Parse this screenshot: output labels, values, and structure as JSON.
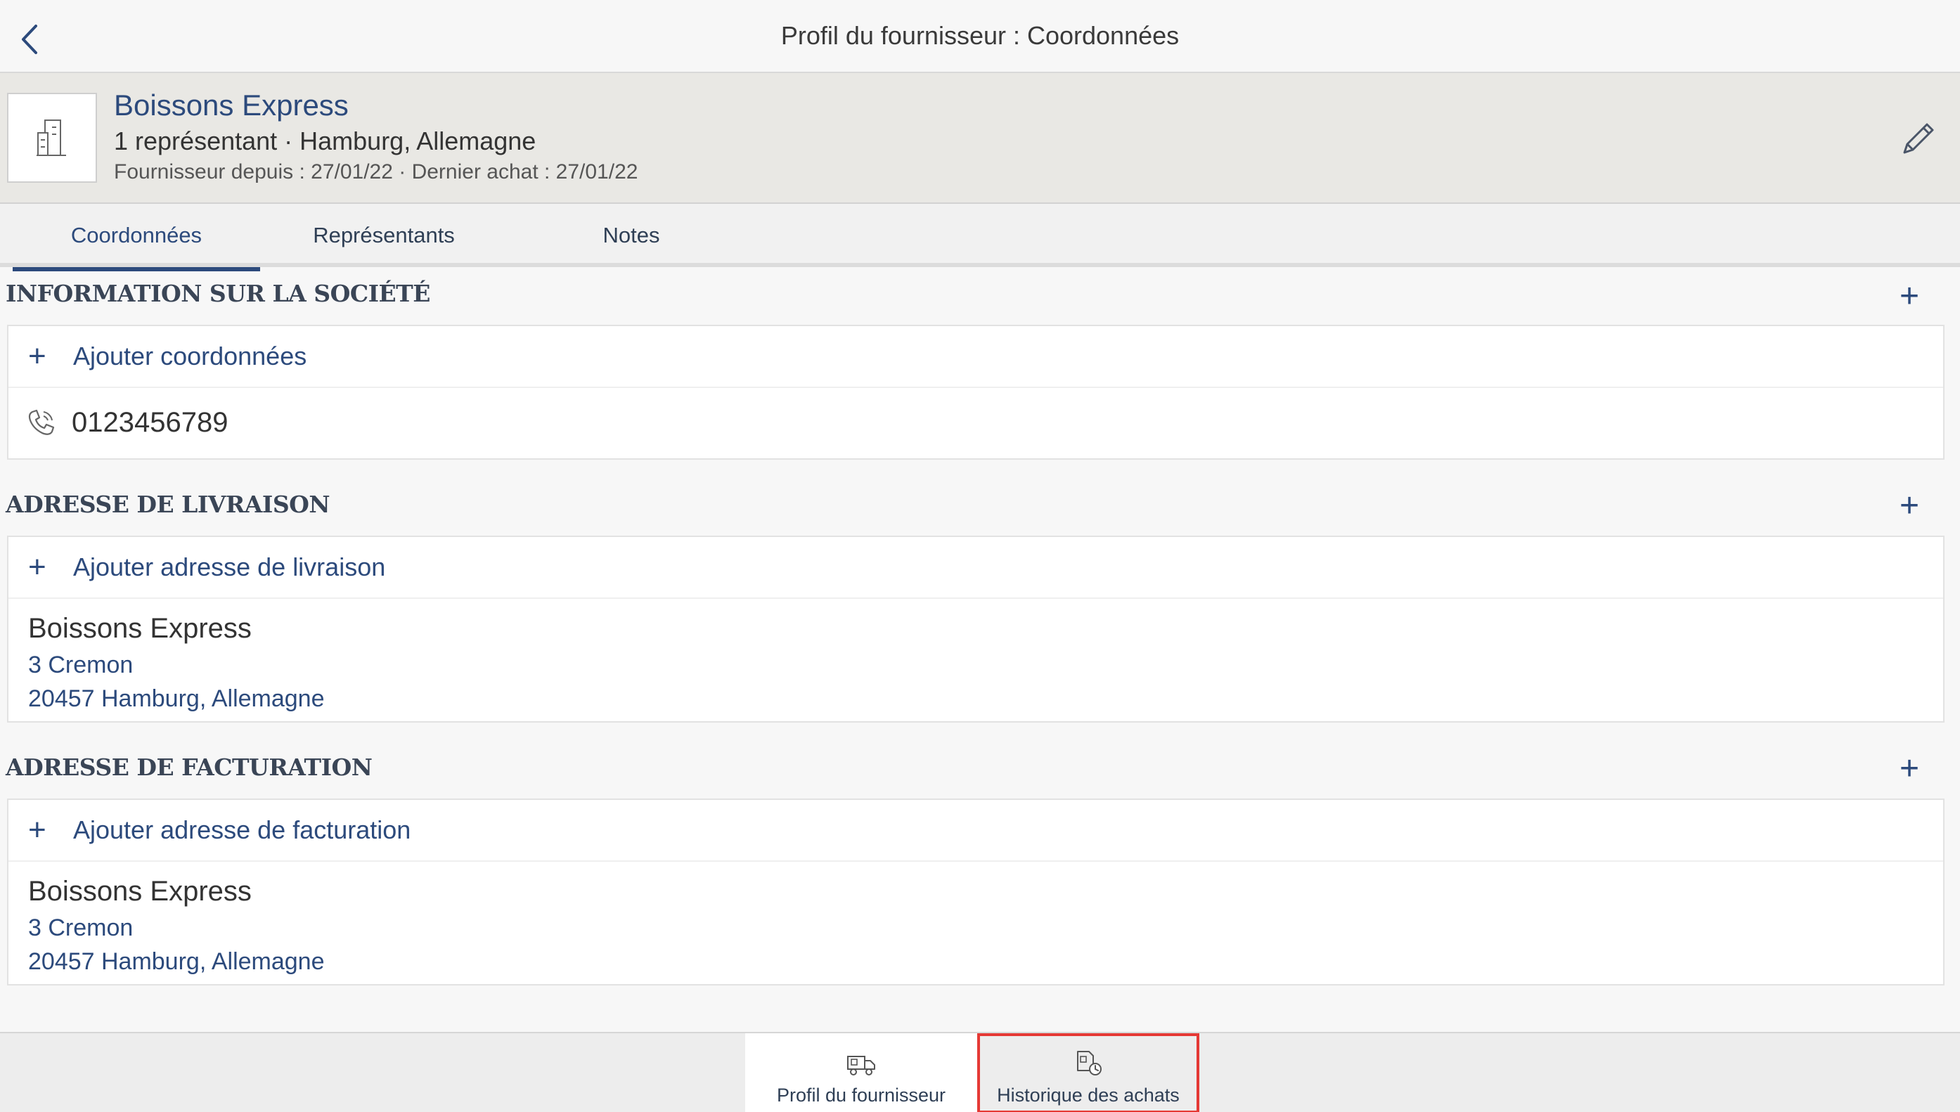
{
  "topbar": {
    "title": "Profil du fournisseur : Coordonnées"
  },
  "supplier": {
    "name": "Boissons Express",
    "subtitle": "1 représentant · Hamburg, Allemagne",
    "meta": "Fournisseur depuis : 27/01/22 · Dernier achat : 27/01/22"
  },
  "tabs": [
    {
      "label": "Coordonnées",
      "active": true
    },
    {
      "label": "Représentants",
      "active": false
    },
    {
      "label": "Notes",
      "active": false
    }
  ],
  "company_info": {
    "title": "INFORMATION SUR LA SOCIÉTÉ",
    "add_label": "Ajouter coordonnées",
    "phone": "0123456789"
  },
  "delivery": {
    "title": "ADRESSE DE LIVRAISON",
    "add_label": "Ajouter adresse de livraison",
    "name": "Boissons Express",
    "street": "3 Cremon",
    "city": "20457 Hamburg, Allemagne"
  },
  "billing": {
    "title": "ADRESSE DE FACTURATION",
    "add_label": "Ajouter adresse de facturation",
    "name": "Boissons Express",
    "street": "3 Cremon",
    "city": "20457 Hamburg, Allemagne"
  },
  "plus_glyph": "+",
  "bottom_nav": [
    {
      "label": "Profil du fournisseur",
      "icon": "truck-icon",
      "active": true
    },
    {
      "label": "Historique des achats",
      "icon": "purchase-history-icon",
      "active": false,
      "highlighted": true
    }
  ],
  "colors": {
    "accent": "#2c4a7c",
    "header_bg": "#e9e8e4",
    "highlight": "#e53935"
  }
}
